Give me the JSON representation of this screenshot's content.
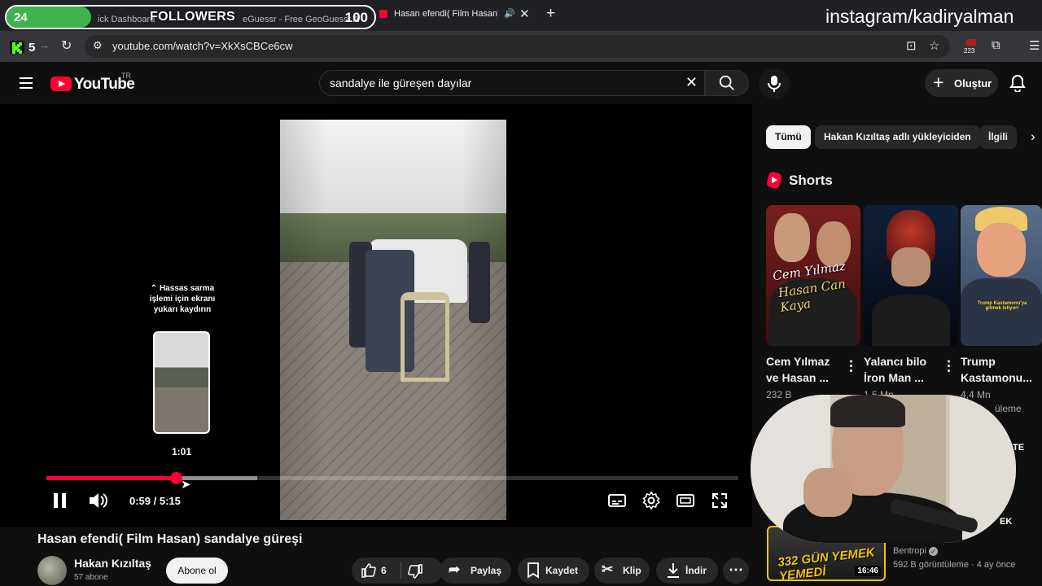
{
  "browser": {
    "overlay_left_count": "24",
    "overlay_followers": "FOLLOWERS",
    "overlay_right_count": "100",
    "tab1_partial": "ick Dashboard",
    "tab2_partial": "eGuessr - Free GeoGuessr A",
    "active_tab_title": "Hasan efendi( Film Hasan) s",
    "url": "youtube.com/watch?v=XkXsCBCe6cw",
    "ext_left_count": "5",
    "ext_badge_count": "223",
    "watermark": "instagram/kadiryalman"
  },
  "masthead": {
    "logo_text": "YouTube",
    "region": "TR",
    "search_value": "sandalye ile güreşen dayılar",
    "create_label": "Oluştur"
  },
  "player": {
    "seek_hint": "⌃ Hassas sarma işlemi için ekranı yukarı kaydırın",
    "preview_time": "1:01",
    "time_display": "0:59 / 5:15",
    "progress": 0.187,
    "buffered": 0.305
  },
  "video": {
    "title": "Hasan efendi( Film Hasan) sandalye güreşi",
    "channel": "Hakan Kızıltaş",
    "subscribers": "57 abone",
    "subscribe_label": "Abone ol",
    "like_count": "6",
    "share_label": "Paylaş",
    "save_label": "Kaydet",
    "clip_label": "Klip",
    "download_label": "İndir"
  },
  "sidebar": {
    "chips": [
      "Tümü",
      "Hakan Kızıltaş adlı yükleyiciden",
      "İlgili"
    ],
    "shorts_heading": "Shorts",
    "shorts": [
      {
        "title": "Cem Yılmaz ve Hasan ...",
        "views": "232 B",
        "thumb_text_1": "Cem Yılmaz",
        "thumb_text_2": "Hasan Can Kaya"
      },
      {
        "title": "Yalancı bilo İron Man ...",
        "views": "1,5 Mn"
      },
      {
        "title": "Trump Kastamonu...",
        "views": "4,4 Mn",
        "views_suffix": "üleme",
        "thumb_text": "Trump Kastamonu'ya gitmek istiyor!"
      }
    ],
    "rec_channel": "Bentropi",
    "rec_meta": "592 B görüntüleme · 4 ay önce",
    "rec_duration": "16:46",
    "rec_thumb_text": "332 GÜN YEMEK YEMEDİ",
    "rec_peek_1": "TE",
    "rec_peek_2": "EK"
  }
}
